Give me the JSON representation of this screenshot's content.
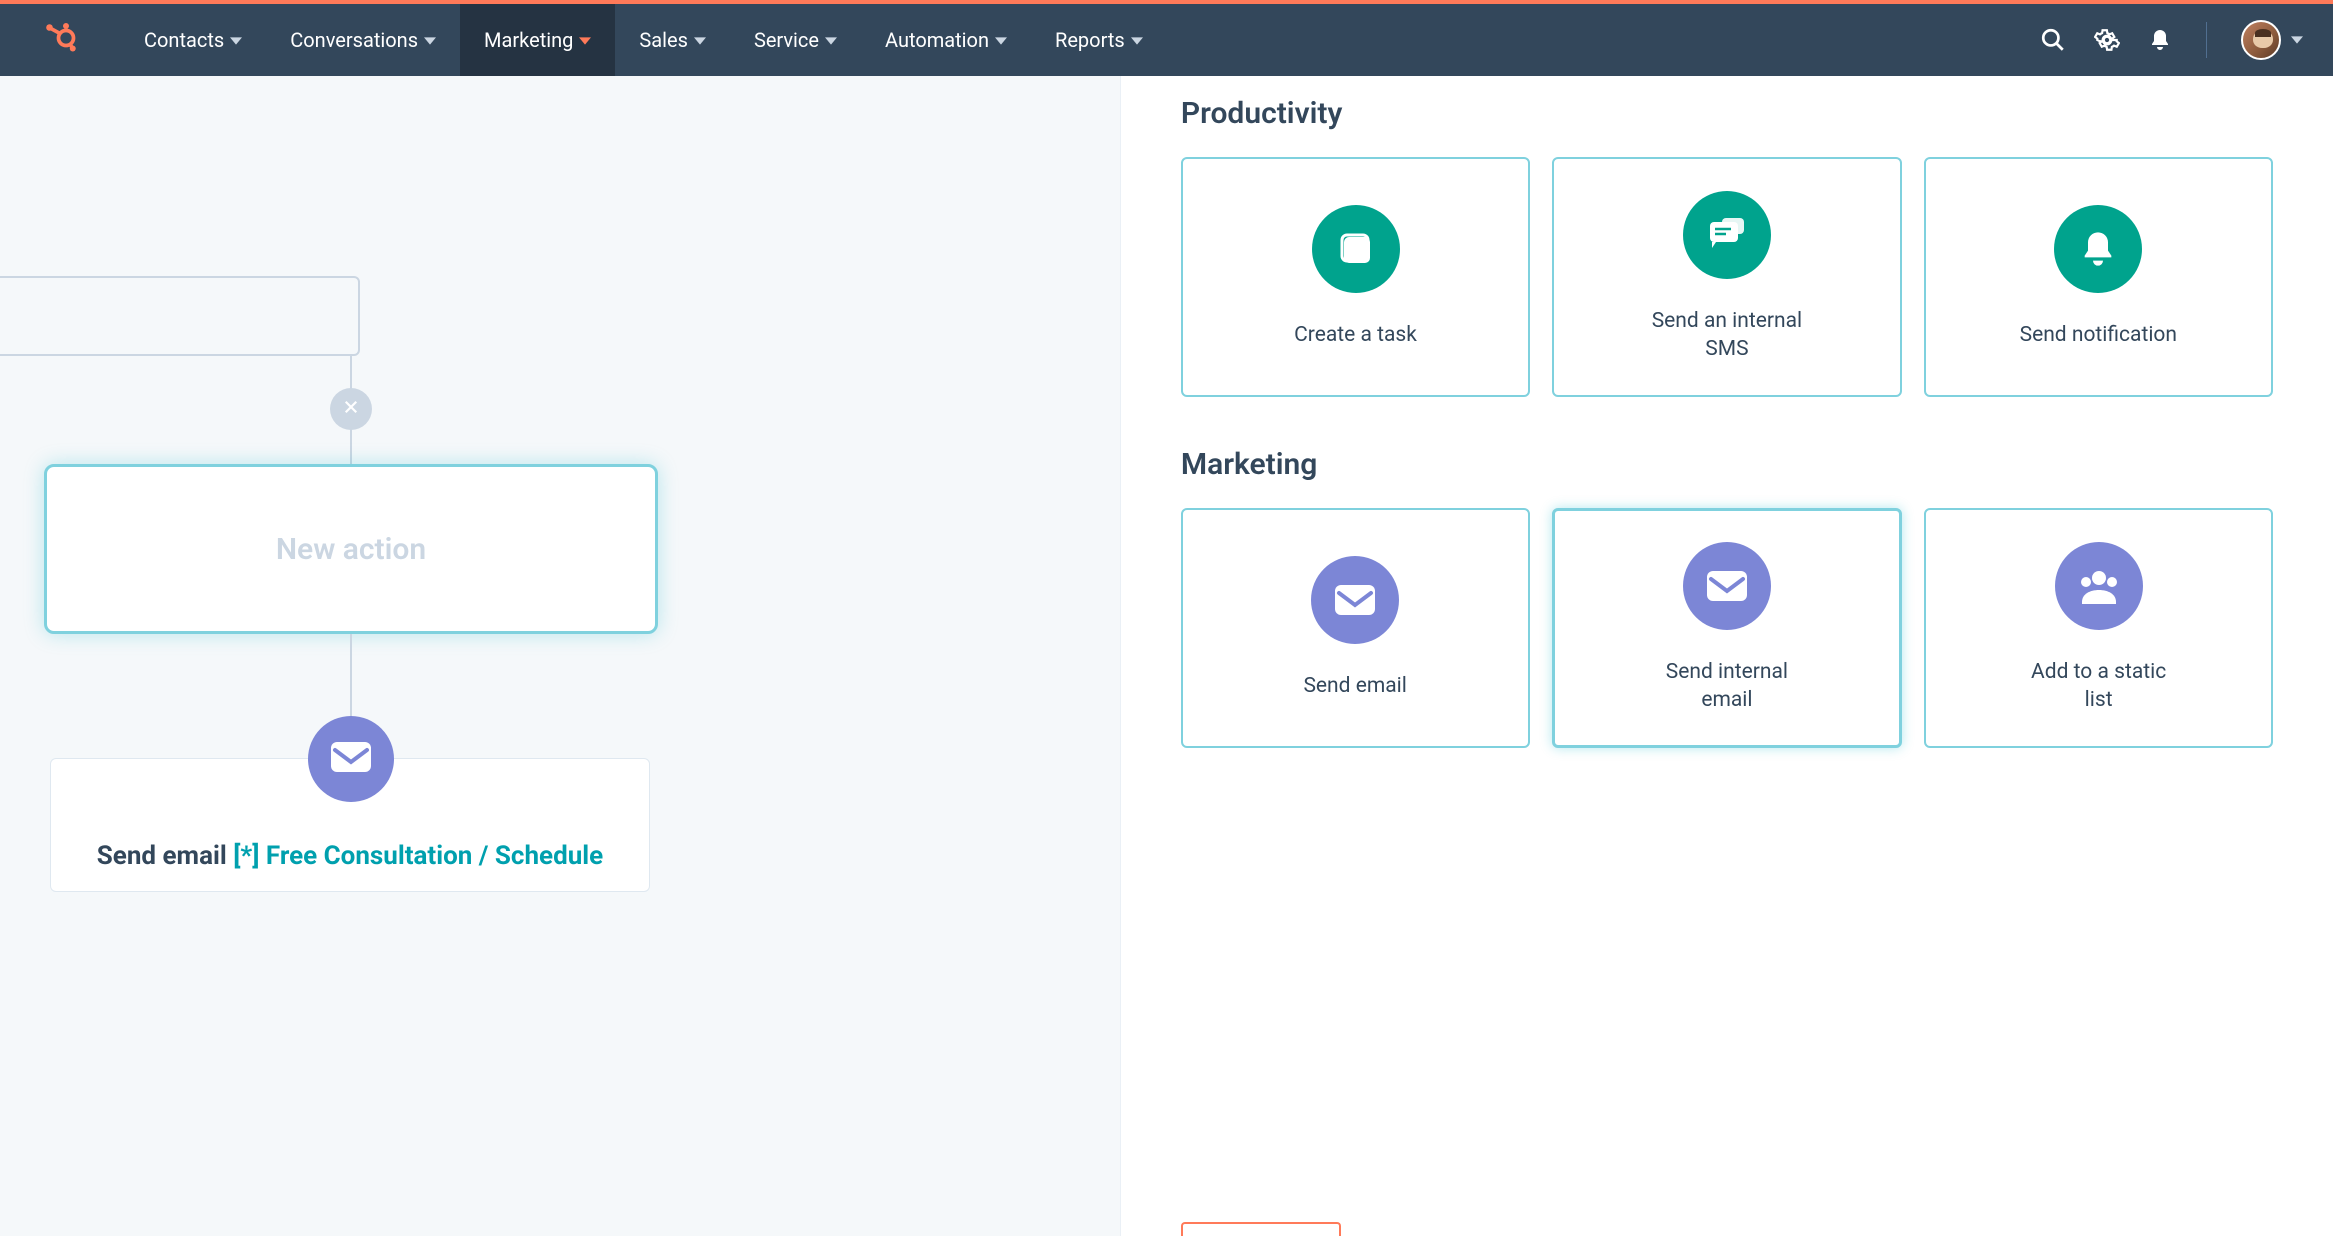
{
  "nav": {
    "items": [
      {
        "label": "Contacts",
        "active": false
      },
      {
        "label": "Conversations",
        "active": false
      },
      {
        "label": "Marketing",
        "active": true
      },
      {
        "label": "Sales",
        "active": false
      },
      {
        "label": "Service",
        "active": false
      },
      {
        "label": "Automation",
        "active": false
      },
      {
        "label": "Reports",
        "active": false
      }
    ]
  },
  "workflow": {
    "new_action_label": "New action",
    "email_step_prefix": "Send email ",
    "email_step_link": "[*] Free Consultation / Schedule"
  },
  "panel": {
    "sections": [
      {
        "title": "Productivity",
        "color": "teal",
        "cards": [
          {
            "label": "Create a task",
            "icon": "task"
          },
          {
            "label": "Send an internal SMS",
            "icon": "sms"
          },
          {
            "label": "Send notification",
            "icon": "bell"
          }
        ]
      },
      {
        "title": "Marketing",
        "color": "purple",
        "cards": [
          {
            "label": "Send email",
            "icon": "email"
          },
          {
            "label": "Send internal email",
            "icon": "email",
            "selected": true
          },
          {
            "label": "Add to a static list",
            "icon": "people"
          }
        ]
      }
    ]
  }
}
